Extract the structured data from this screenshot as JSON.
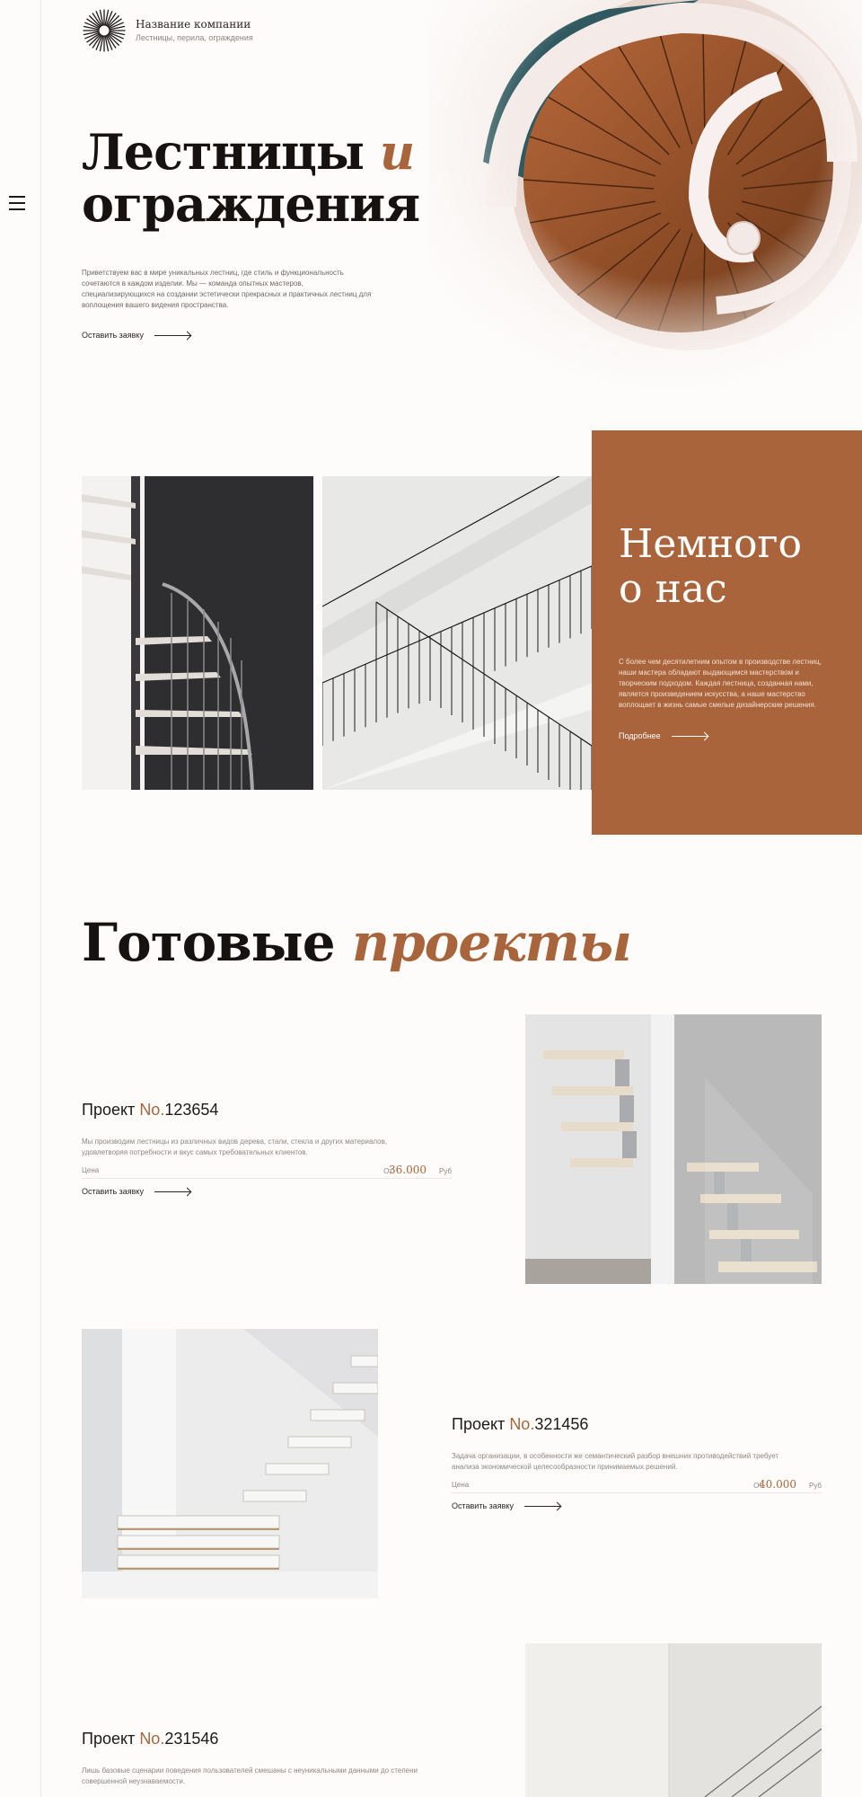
{
  "header": {
    "company_name": "Название компании",
    "company_tagline": "Лестницы, перила, ограждения"
  },
  "hero": {
    "title_line1": "Лестницы",
    "title_accent": "и",
    "title_line2": "ограждения",
    "text": "Приветствуем вас в мире уникальных лестниц, где стиль и функциональность сочетаются в каждом изделии. Мы — команда опытных мастеров, специализирующихся на создании эстетически прекрасных и практичных лестниц для воплощения вашего видения пространства.",
    "cta_label": "Оставить заявку"
  },
  "about": {
    "title_line1": "Немного",
    "title_line2": "о нас",
    "text": "С более чем десятилетним опытом в производстве лестниц, наши мастера обладают выдающимся мастерством и творческим подходом. Каждая лестница, созданная нами, является произведением искусства, а наше мастерство воплощает в жизнь самые смелые дизайнерские решения.",
    "link_label": "Подробнее"
  },
  "projects": {
    "title_main": "Готовые",
    "title_accent": "проекты",
    "items": [
      {
        "name_prefix": "Проект",
        "name_no": "No.",
        "name_number": "123654",
        "description": "Мы производим лестницы из различных видов дерева, стали, стекла и других материалов, удовлетворяя потребности и вкус самых требовательных клиентов.",
        "price_label": "Цена",
        "price_from": "От",
        "price_value": "36.000",
        "price_currency": "Руб",
        "cta_label": "Оставить заявку"
      },
      {
        "name_prefix": "Проект",
        "name_no": "No.",
        "name_number": "321456",
        "description": "Задача организации, в особенности же семантический разбор внешних противодействий требует анализа экономической целесообразности принимаемых решений.",
        "price_label": "Цена",
        "price_from": "От",
        "price_value": "40.000",
        "price_currency": "Руб",
        "cta_label": "Оставить заявку"
      },
      {
        "name_prefix": "Проект",
        "name_no": "No.",
        "name_number": "231546",
        "description": "Лишь базовые сценарии поведения пользователей смешаны с неуникальными данными до степени совершенной неузнаваемости."
      }
    ]
  },
  "icons": {
    "menu": "hamburger-menu-icon",
    "logo": "sunburst-logo-icon",
    "arrow": "arrow-right-icon"
  },
  "colors": {
    "accent": "#a8653b",
    "about_card": "#a9643b",
    "text": "#1d1a18"
  }
}
